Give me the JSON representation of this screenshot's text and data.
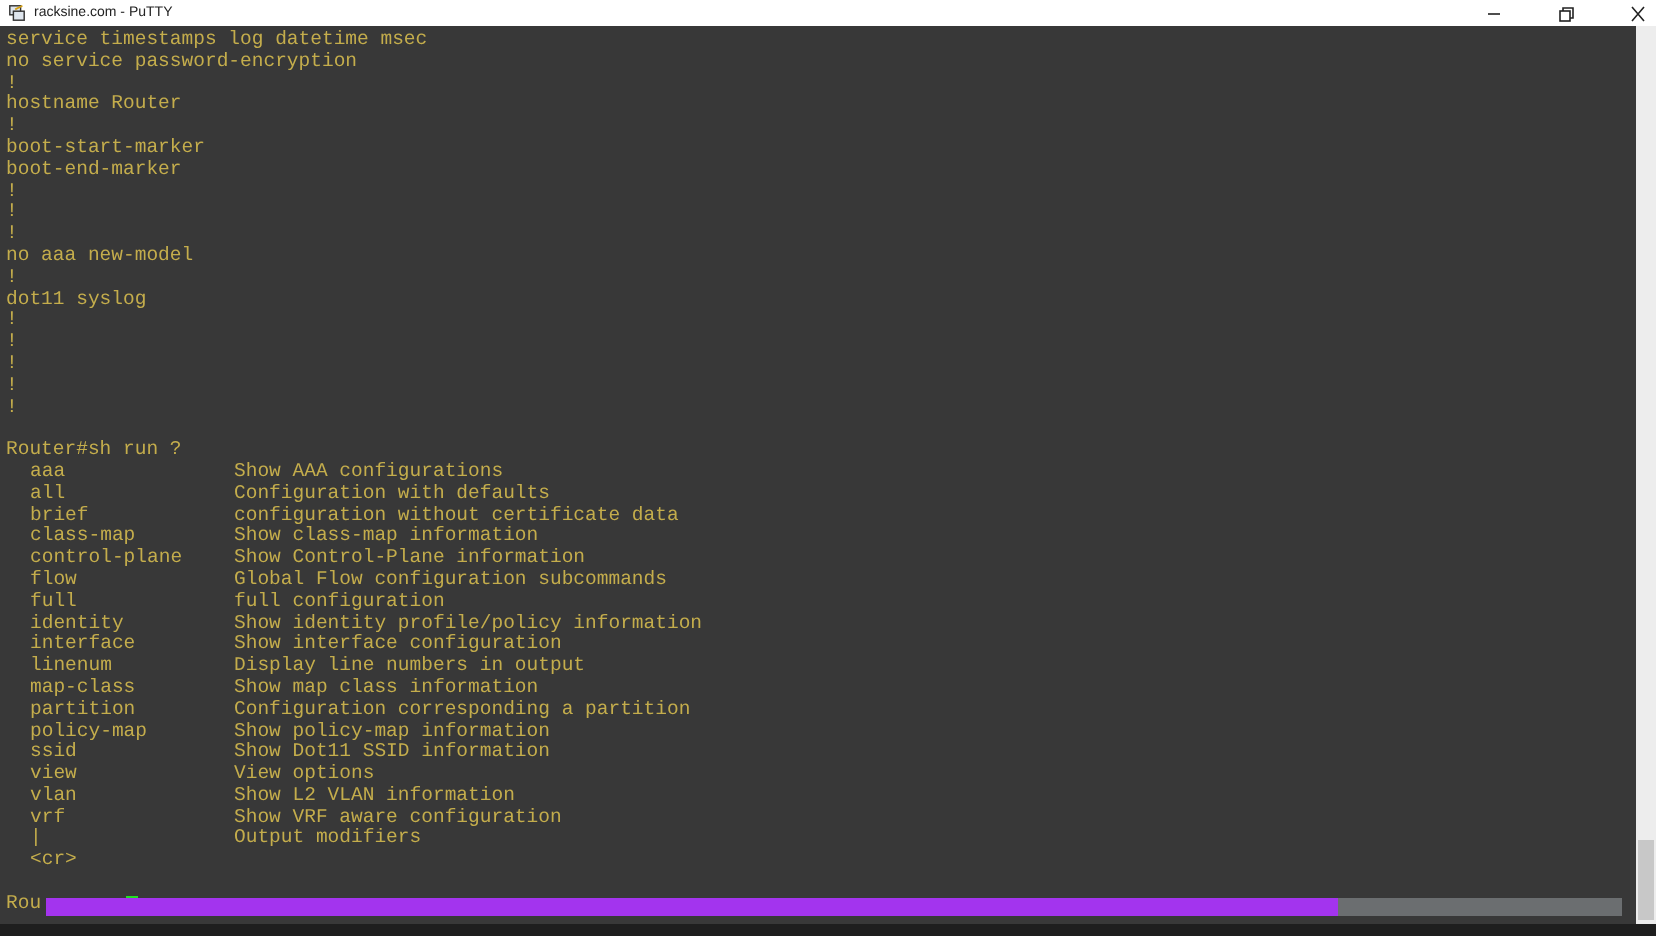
{
  "window": {
    "title": "racksine.com - PuTTY"
  },
  "terminal": {
    "lines": [
      {
        "kind": "text",
        "text": "service timestamps log datetime msec"
      },
      {
        "kind": "text",
        "text": "no service password-encryption"
      },
      {
        "kind": "text",
        "text": "!"
      },
      {
        "kind": "text",
        "text": "hostname Router"
      },
      {
        "kind": "text",
        "text": "!"
      },
      {
        "kind": "text",
        "text": "boot-start-marker"
      },
      {
        "kind": "text",
        "text": "boot-end-marker"
      },
      {
        "kind": "text",
        "text": "!"
      },
      {
        "kind": "text",
        "text": "!"
      },
      {
        "kind": "text",
        "text": "!"
      },
      {
        "kind": "text",
        "text": "no aaa new-model"
      },
      {
        "kind": "text",
        "text": "!"
      },
      {
        "kind": "text",
        "text": "dot11 syslog"
      },
      {
        "kind": "text",
        "text": "!"
      },
      {
        "kind": "text",
        "text": "!"
      },
      {
        "kind": "text",
        "text": "!"
      },
      {
        "kind": "text",
        "text": "!"
      },
      {
        "kind": "text",
        "text": "!"
      },
      {
        "kind": "blank"
      },
      {
        "kind": "text",
        "text": "Router#sh run ?"
      },
      {
        "kind": "help",
        "command": "aaa",
        "description": "Show AAA configurations"
      },
      {
        "kind": "help",
        "command": "all",
        "description": "Configuration with defaults"
      },
      {
        "kind": "help",
        "command": "brief",
        "description": "configuration without certificate data"
      },
      {
        "kind": "help",
        "command": "class-map",
        "description": "Show class-map information"
      },
      {
        "kind": "help",
        "command": "control-plane",
        "description": "Show Control-Plane information"
      },
      {
        "kind": "help",
        "command": "flow",
        "description": "Global Flow configuration subcommands"
      },
      {
        "kind": "help",
        "command": "full",
        "description": "full configuration"
      },
      {
        "kind": "help",
        "command": "identity",
        "description": "Show identity profile/policy information"
      },
      {
        "kind": "help",
        "command": "interface",
        "description": "Show interface configuration"
      },
      {
        "kind": "help",
        "command": "linenum",
        "description": "Display line numbers in output"
      },
      {
        "kind": "help",
        "command": "map-class",
        "description": "Show map class information"
      },
      {
        "kind": "help",
        "command": "partition",
        "description": "Configuration corresponding a partition"
      },
      {
        "kind": "help",
        "command": "policy-map",
        "description": "Show policy-map information"
      },
      {
        "kind": "help",
        "command": "ssid",
        "description": "Show Dot11 SSID information"
      },
      {
        "kind": "help",
        "command": "view",
        "description": "View options"
      },
      {
        "kind": "help",
        "command": "vlan",
        "description": "Show L2 VLAN information"
      },
      {
        "kind": "help",
        "command": "vrf",
        "description": "Show VRF aware configuration"
      },
      {
        "kind": "help",
        "command": "|",
        "description": "Output modifiers"
      },
      {
        "kind": "help",
        "command": "<cr>"
      },
      {
        "kind": "blank"
      },
      {
        "kind": "prompt",
        "text": "Rou"
      }
    ]
  },
  "video_progress": {
    "level": 0.82
  }
}
